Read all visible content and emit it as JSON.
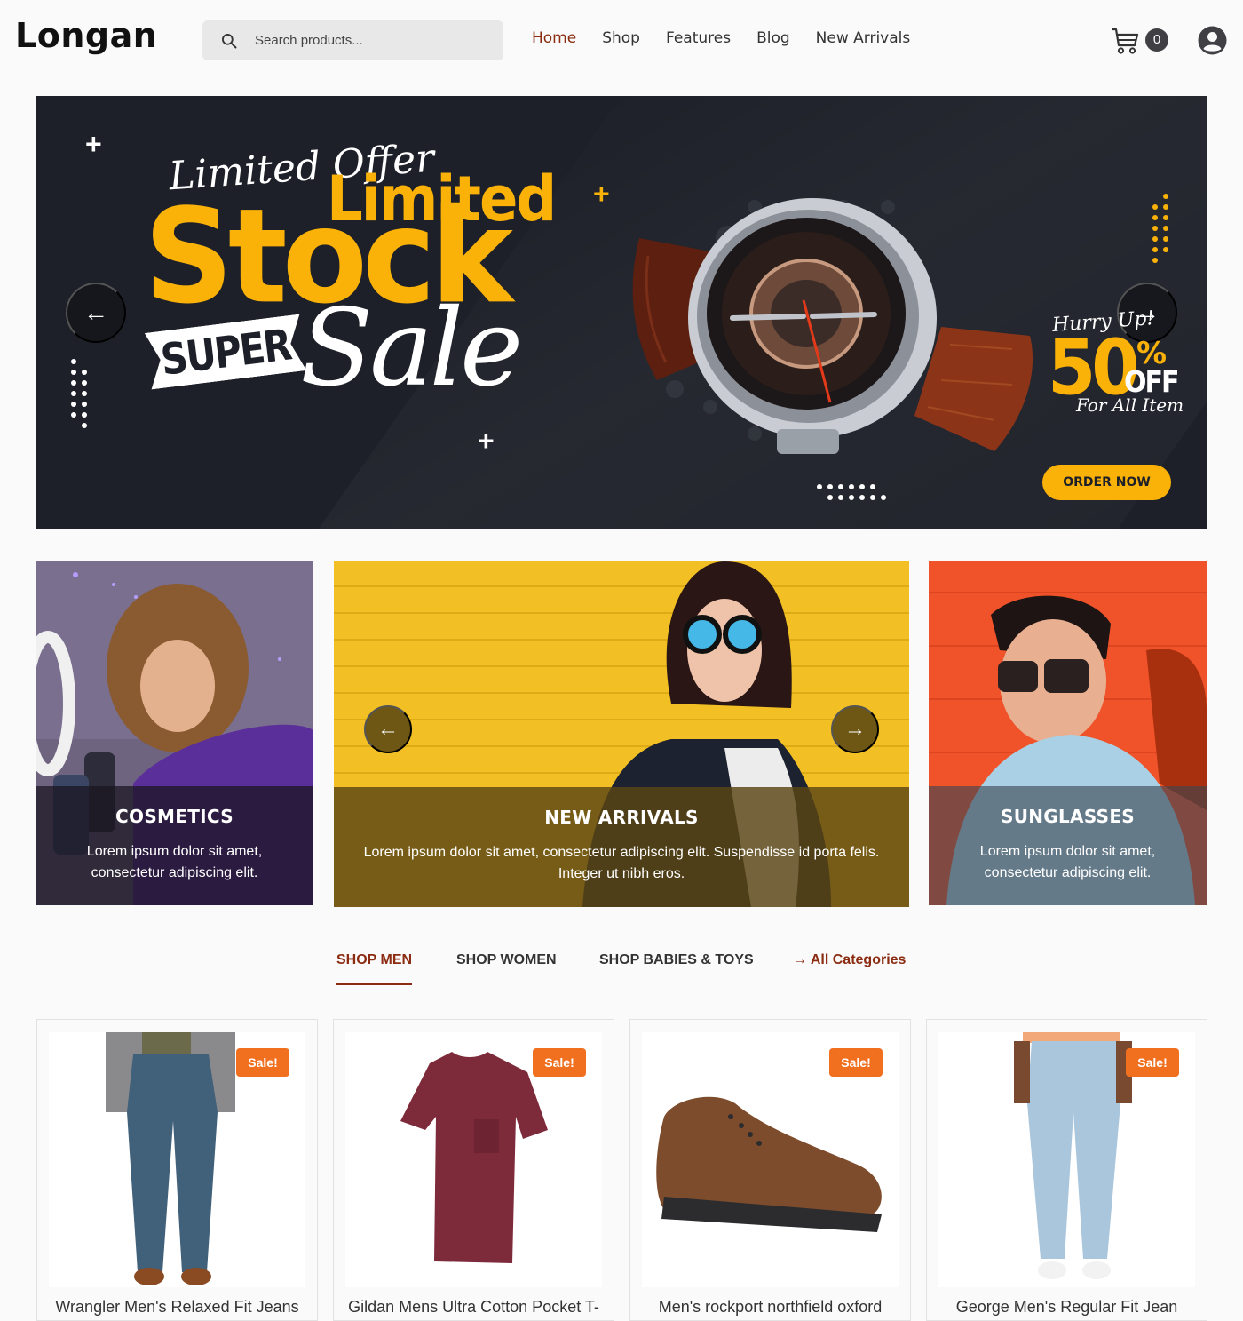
{
  "header": {
    "logo": "Longan",
    "search_placeholder": "Search products...",
    "nav": [
      {
        "label": "Home",
        "active": true
      },
      {
        "label": "Shop"
      },
      {
        "label": "Features"
      },
      {
        "label": "Blog"
      },
      {
        "label": "New Arrivals"
      }
    ],
    "cart_count": "0"
  },
  "hero": {
    "script_title": "Limited Offer",
    "headline_top": "Limited",
    "headline_main": "Stock",
    "ribbon": "SUPER",
    "script_sale": "Sale",
    "hurry": "Hurry Up!",
    "discount_value": "50",
    "discount_percent": "%",
    "discount_off": "OFF",
    "for_all": "For All Item",
    "order_button": "ORDER NOW",
    "prev_arrow": "←",
    "next_arrow": "→",
    "accent_color": "#fbb208",
    "background_color": "#1d2028"
  },
  "categories": [
    {
      "title": "COSMETICS",
      "description": "Lorem ipsum dolor sit amet, consectetur adipiscing elit."
    },
    {
      "title": "NEW ARRIVALS",
      "description": "Lorem ipsum dolor sit amet, consectetur adipiscing elit. Suspendisse id porta felis. Integer ut nibh eros.",
      "prev_arrow": "←",
      "next_arrow": "→"
    },
    {
      "title": "SUNGLASSES",
      "description": "Lorem ipsum dolor sit amet, consectetur adipiscing elit."
    }
  ],
  "shop_tabs": [
    {
      "label": "SHOP MEN",
      "active": true
    },
    {
      "label": "SHOP WOMEN"
    },
    {
      "label": "SHOP BABIES & TOYS"
    },
    {
      "label": "→ All Categories"
    }
  ],
  "products": [
    {
      "name": "Wrangler Men's Relaxed Fit Jeans",
      "badge": "Sale!"
    },
    {
      "name": "Gildan Mens Ultra Cotton Pocket T-",
      "badge": "Sale!"
    },
    {
      "name": "Men's rockport northfield oxford",
      "badge": "Sale!"
    },
    {
      "name": "George Men's Regular Fit Jean",
      "badge": "Sale!"
    }
  ],
  "colors": {
    "brand_accent": "#8b2c12",
    "sale_badge": "#f07020"
  }
}
